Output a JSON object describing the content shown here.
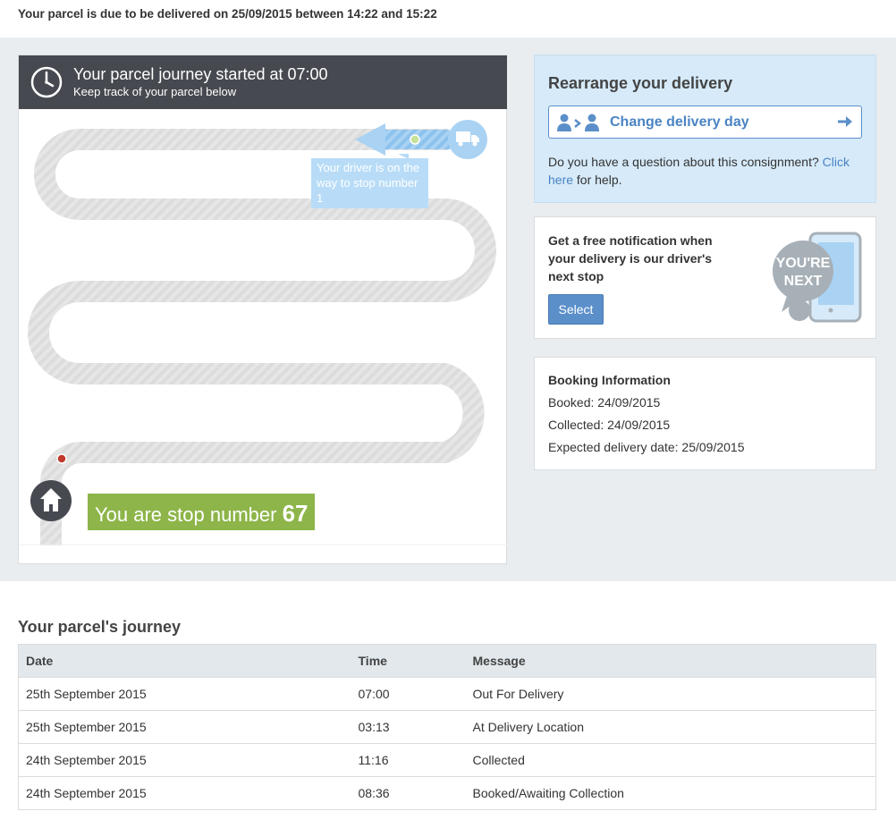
{
  "delivery_notice": "Your parcel is due to be delivered on 25/09/2015 between 14:22 and 15:22",
  "journey_card": {
    "title": "Your parcel journey started at 07:00",
    "subtitle": "Keep track of your parcel below",
    "driver_tip": "Your driver is on the way to stop number 1",
    "stop_prefix": "You are stop number",
    "stop_number": "67",
    "icons": [
      "clock-icon",
      "truck-icon",
      "home-icon"
    ]
  },
  "rearrange": {
    "title": "Rearrange your delivery",
    "button_label": "Change delivery day",
    "question_text": "Do you have a question about this consignment?",
    "link_text": "Click here",
    "question_suffix": "for help."
  },
  "notification": {
    "text": "Get a free notification when your delivery is our driver's next stop",
    "select_label": "Select",
    "badge_text_1": "YOU'RE",
    "badge_text_2": "NEXT"
  },
  "booking": {
    "title": "Booking Information",
    "booked": "Booked: 24/09/2015",
    "collected": "Collected: 24/09/2015",
    "expected": "Expected delivery date: 25/09/2015"
  },
  "journey_table": {
    "title": "Your parcel's journey",
    "headers": [
      "Date",
      "Time",
      "Message"
    ],
    "rows": [
      [
        "25th September 2015",
        "07:00",
        "Out For Delivery"
      ],
      [
        "25th September 2015",
        "03:13",
        "At Delivery Location"
      ],
      [
        "24th September 2015",
        "11:16",
        "Collected"
      ],
      [
        "24th September 2015",
        "08:36",
        "Booked/Awaiting Collection"
      ]
    ]
  },
  "colors": {
    "header_dark": "#464950",
    "panel_blue": "#d6eaf9",
    "accent_blue": "#5b8fc9",
    "stop_green": "#8db549",
    "band_grey": "#e9edf0"
  }
}
